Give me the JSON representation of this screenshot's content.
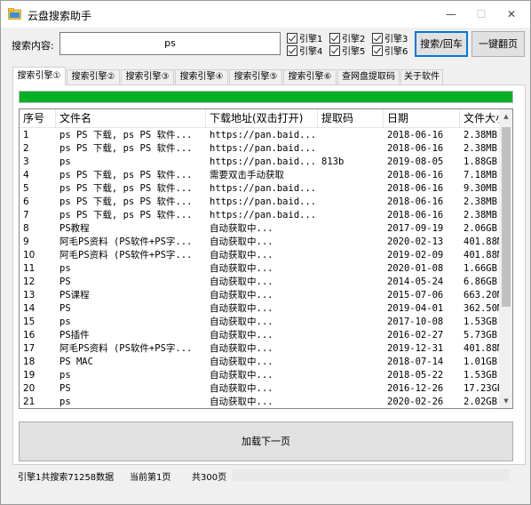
{
  "window": {
    "title": "云盘搜索助手",
    "min_glyph": "—",
    "max_glyph": "☐",
    "close_glyph": "✕"
  },
  "search": {
    "label": "搜索内容:",
    "value": "ps",
    "engines": [
      {
        "label": "引擎1",
        "checked": true
      },
      {
        "label": "引擎2",
        "checked": true
      },
      {
        "label": "引擎3",
        "checked": true
      },
      {
        "label": "引擎4",
        "checked": true
      },
      {
        "label": "引擎5",
        "checked": true
      },
      {
        "label": "引擎6",
        "checked": true
      }
    ],
    "search_button": "搜索/回车",
    "flip_button": "一键翻页"
  },
  "tabs": [
    "搜索引擎①",
    "搜索引擎②",
    "搜索引擎③",
    "搜索引擎④",
    "搜索引擎⑤",
    "搜索引擎⑥",
    "查网盘提取码",
    "关于软件"
  ],
  "progress": {
    "fraction": 1.0,
    "color": "#06b025"
  },
  "table": {
    "columns": [
      "序号",
      "文件名",
      "下载地址(双击打开)",
      "提取码",
      "日期",
      "文件大小"
    ],
    "rows": [
      [
        "1",
        "ps PS 下载, ps PS 软件...",
        "https://pan.baid...",
        "",
        "2018-06-16",
        "2.38MB"
      ],
      [
        "2",
        "ps PS 下载, ps PS 软件...",
        "https://pan.baid...",
        "",
        "2018-06-16",
        "2.38MB"
      ],
      [
        "3",
        "ps",
        "https://pan.baid...",
        "813b",
        "2019-08-05",
        "1.88GB"
      ],
      [
        "4",
        "ps PS 下载, ps PS 软件...",
        "需要双击手动获取",
        "",
        "2018-06-16",
        "7.18MB"
      ],
      [
        "5",
        "ps PS 下载, ps PS 软件...",
        "https://pan.baid...",
        "",
        "2018-06-16",
        "9.30MB"
      ],
      [
        "6",
        "ps PS 下载, ps PS 软件...",
        "https://pan.baid...",
        "",
        "2018-06-16",
        "2.38MB"
      ],
      [
        "7",
        "ps PS 下载, ps PS 软件...",
        "https://pan.baid...",
        "",
        "2018-06-16",
        "2.38MB"
      ],
      [
        "8",
        "PS教程",
        "自动获取中...",
        "",
        "2017-09-19",
        "2.06GB"
      ],
      [
        "9",
        "阿毛PS资料 (PS软件+PS字...",
        "自动获取中...",
        "",
        "2020-02-13",
        "401.88M"
      ],
      [
        "10",
        "阿毛PS资料 (PS软件+PS字...",
        "自动获取中...",
        "",
        "2019-02-09",
        "401.88M"
      ],
      [
        "11",
        "ps",
        "自动获取中...",
        "",
        "2020-01-08",
        "1.66GB"
      ],
      [
        "12",
        "PS",
        "自动获取中...",
        "",
        "2014-05-24",
        "6.86GB"
      ],
      [
        "13",
        "PS课程",
        "自动获取中...",
        "",
        "2015-07-06",
        "663.20M"
      ],
      [
        "14",
        "PS",
        "自动获取中...",
        "",
        "2019-04-01",
        "362.50M"
      ],
      [
        "15",
        "ps",
        "自动获取中...",
        "",
        "2017-10-08",
        "1.53GB"
      ],
      [
        "16",
        "PS插件",
        "自动获取中...",
        "",
        "2016-02-27",
        "5.73GB"
      ],
      [
        "17",
        "阿毛PS资料 (PS软件+PS字...",
        "自动获取中...",
        "",
        "2019-12-31",
        "401.88M"
      ],
      [
        "18",
        "PS MAC",
        "自动获取中...",
        "",
        "2018-07-14",
        "1.01GB"
      ],
      [
        "19",
        "ps",
        "自动获取中...",
        "",
        "2018-05-22",
        "1.53GB"
      ],
      [
        "20",
        "PS",
        "自动获取中...",
        "",
        "2016-12-26",
        "17.23GB"
      ],
      [
        "21",
        "ps",
        "自动获取中...",
        "",
        "2020-02-26",
        "2.02GB"
      ]
    ]
  },
  "load_more": "加载下一页",
  "status": {
    "summary": "引擎1共搜索71258数据",
    "current_page": "当前第1页",
    "total_pages": "共300页"
  }
}
